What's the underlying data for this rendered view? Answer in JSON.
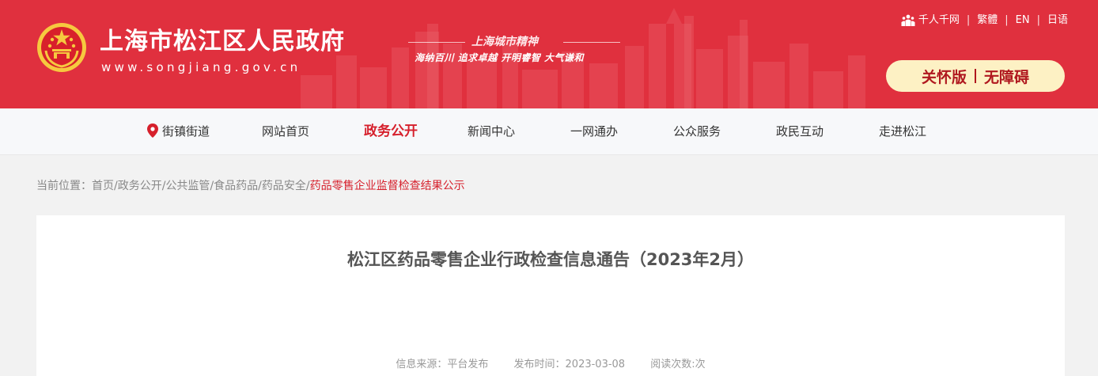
{
  "header": {
    "site_title": "上海市松江区人民政府",
    "site_url": "www.songjiang.gov.cn",
    "spirit_title": "上海城市精神",
    "spirit_slogan": "海纳百川  追求卓越  开明睿智  大气谦和",
    "top_links": {
      "thousands": "千人千网",
      "traditional": "繁體",
      "english": "EN",
      "japanese": "日语"
    },
    "care_version": "关怀版",
    "accessibility": "无障碍"
  },
  "nav": {
    "streets": "街镇街道",
    "home": "网站首页",
    "gov_open": "政务公开",
    "news": "新闻中心",
    "one_net": "一网通办",
    "public_service": "公众服务",
    "interaction": "政民互动",
    "about": "走进松江"
  },
  "breadcrumb": {
    "prefix": "当前位置：",
    "items": [
      "首页",
      "政务公开",
      "公共监管",
      "食品药品",
      "药品安全"
    ],
    "current": "药品零售企业监督检查结果公示",
    "separator": "/"
  },
  "article": {
    "title": "松江区药品零售企业行政检查信息通告（2023年2月）",
    "source_label": "信息来源：",
    "source": "平台发布",
    "date_label": "发布时间：",
    "date": "2023-03-08",
    "views_label": "阅读次数:",
    "views_unit": "次"
  },
  "colors": {
    "banner_red": "#e0303e",
    "accent_red": "#d6202c",
    "pill_bg": "#fdf1c4",
    "nav_bg": "#f7f8fa",
    "page_bg": "#f2f2f2"
  },
  "icons": {
    "emblem": "national-emblem-icon",
    "people": "people-icon",
    "location": "map-pin-icon"
  }
}
